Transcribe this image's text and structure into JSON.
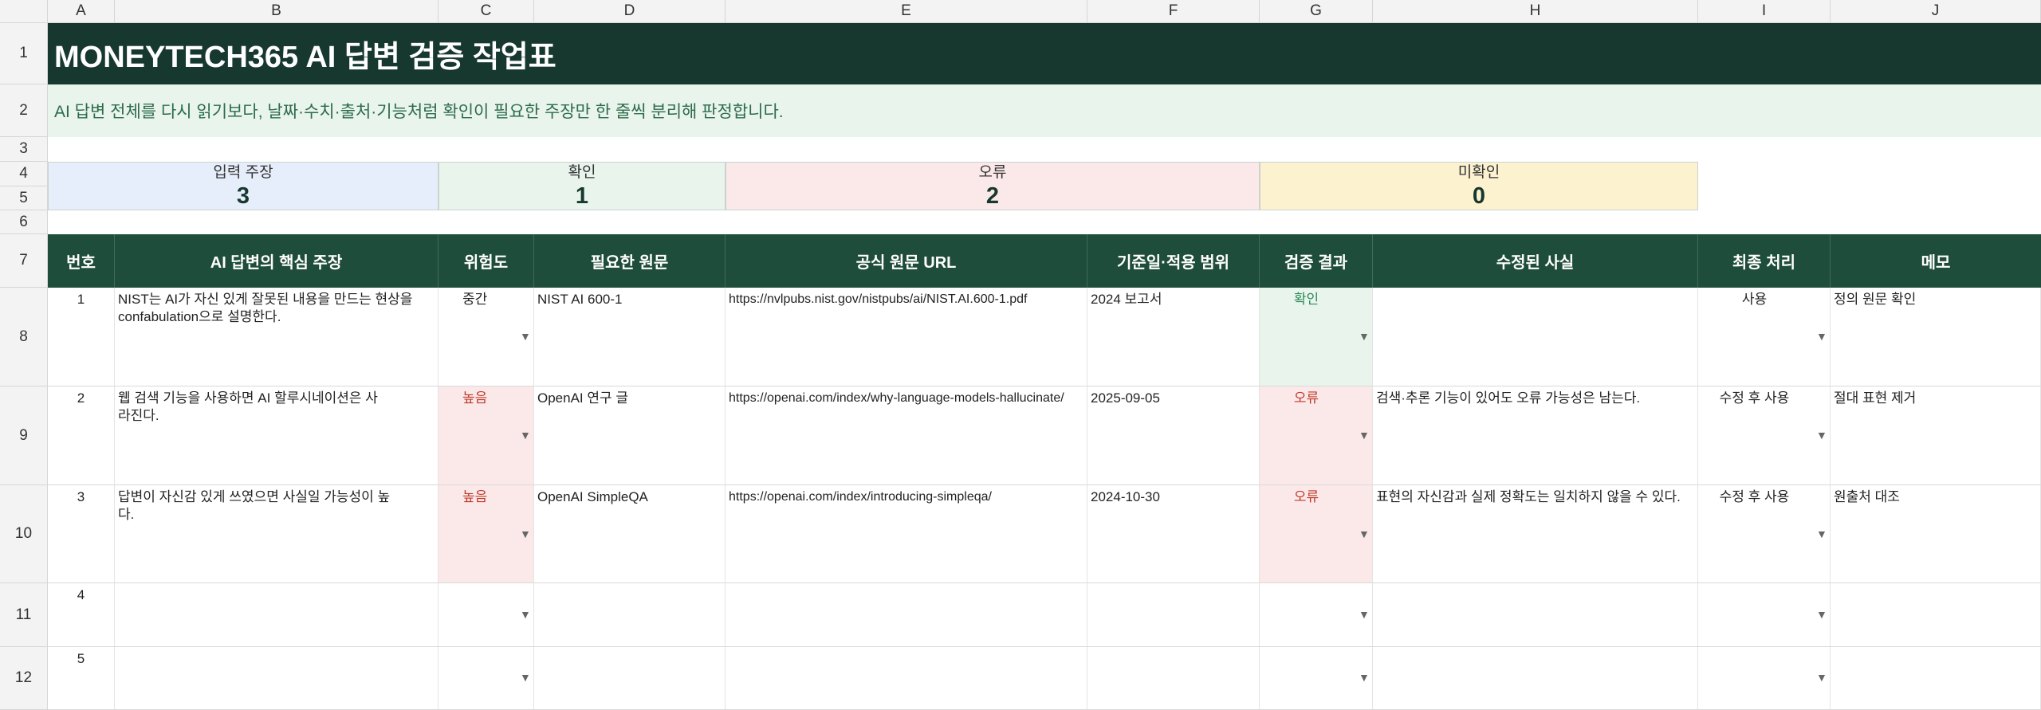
{
  "columns": [
    "A",
    "B",
    "C",
    "D",
    "E",
    "F",
    "G",
    "H",
    "I",
    "J"
  ],
  "rows": [
    "1",
    "2",
    "3",
    "4",
    "5",
    "6",
    "7",
    "8",
    "9",
    "10",
    "11",
    "12"
  ],
  "title": "MONEYTECH365 AI 답변 검증 작업표",
  "subtitle": "AI 답변 전체를 다시 읽기보다, 날짜·수치·출처·기능처럼 확인이 필요한 주장만 한 줄씩 분리해 판정합니다.",
  "kpis": [
    {
      "label": "입력 주장",
      "value": "3",
      "color": "#e7eefb"
    },
    {
      "label": "확인",
      "value": "1",
      "color": "#e8f4ec"
    },
    {
      "label": "오류",
      "value": "2",
      "color": "#fbe9e9"
    },
    {
      "label": "미확인",
      "value": "0",
      "color": "#fdf2d0"
    }
  ],
  "headers": [
    "번호",
    "AI 답변의 핵심 주장",
    "위험도",
    "필요한 원문",
    "공식 원문 URL",
    "기준일·적용 범위",
    "검증 결과",
    "수정된 사실",
    "최종 처리",
    "메모"
  ],
  "records": [
    {
      "no": "1",
      "claim": "NIST는 AI가 자신 있게 잘못된 내용을 만드는 현상을 confabulation으로 설명한다.",
      "risk": "중간",
      "source": "NIST AI 600-1",
      "url": "https://nvlpubs.nist.gov/nistpubs/ai/NIST.AI.600-1.pdf",
      "scope": "2024 보고서",
      "result": "확인",
      "fact": "",
      "action": "사용",
      "memo": "정의 원문 확인"
    },
    {
      "no": "2",
      "claim": "웹 검색 기능을 사용하면 AI 할루시네이션은 사라진다.",
      "risk": "높음",
      "source": "OpenAI 연구 글",
      "url": "https://openai.com/index/why-language-models-hallucinate/",
      "scope": "2025-09-05",
      "result": "오류",
      "fact": "검색·추론 기능이 있어도 오류 가능성은 남는다.",
      "action": "수정 후 사용",
      "memo": "절대 표현 제거"
    },
    {
      "no": "3",
      "claim": "답변이 자신감 있게 쓰였으면 사실일 가능성이 높다.",
      "risk": "높음",
      "source": "OpenAI SimpleQA",
      "url": "https://openai.com/index/introducing-simpleqa/",
      "scope": "2024-10-30",
      "result": "오류",
      "fact": "표현의 자신감과 실제 정확도는 일치하지 않을 수 있다.",
      "action": "수정 후 사용",
      "memo": "원출처 대조"
    },
    {
      "no": "4",
      "claim": "",
      "risk": "",
      "source": "",
      "url": "",
      "scope": "",
      "result": "",
      "fact": "",
      "action": "",
      "memo": ""
    },
    {
      "no": "5",
      "claim": "",
      "risk": "",
      "source": "",
      "url": "",
      "scope": "",
      "result": "",
      "fact": "",
      "action": "",
      "memo": ""
    }
  ],
  "icons": {
    "dropdown": "dropdown-arrow-icon"
  },
  "colors": {
    "title_bg": "#16382e",
    "header_bg": "#1f4d3b",
    "error": "#c0392b",
    "ok": "#2e8b57"
  }
}
